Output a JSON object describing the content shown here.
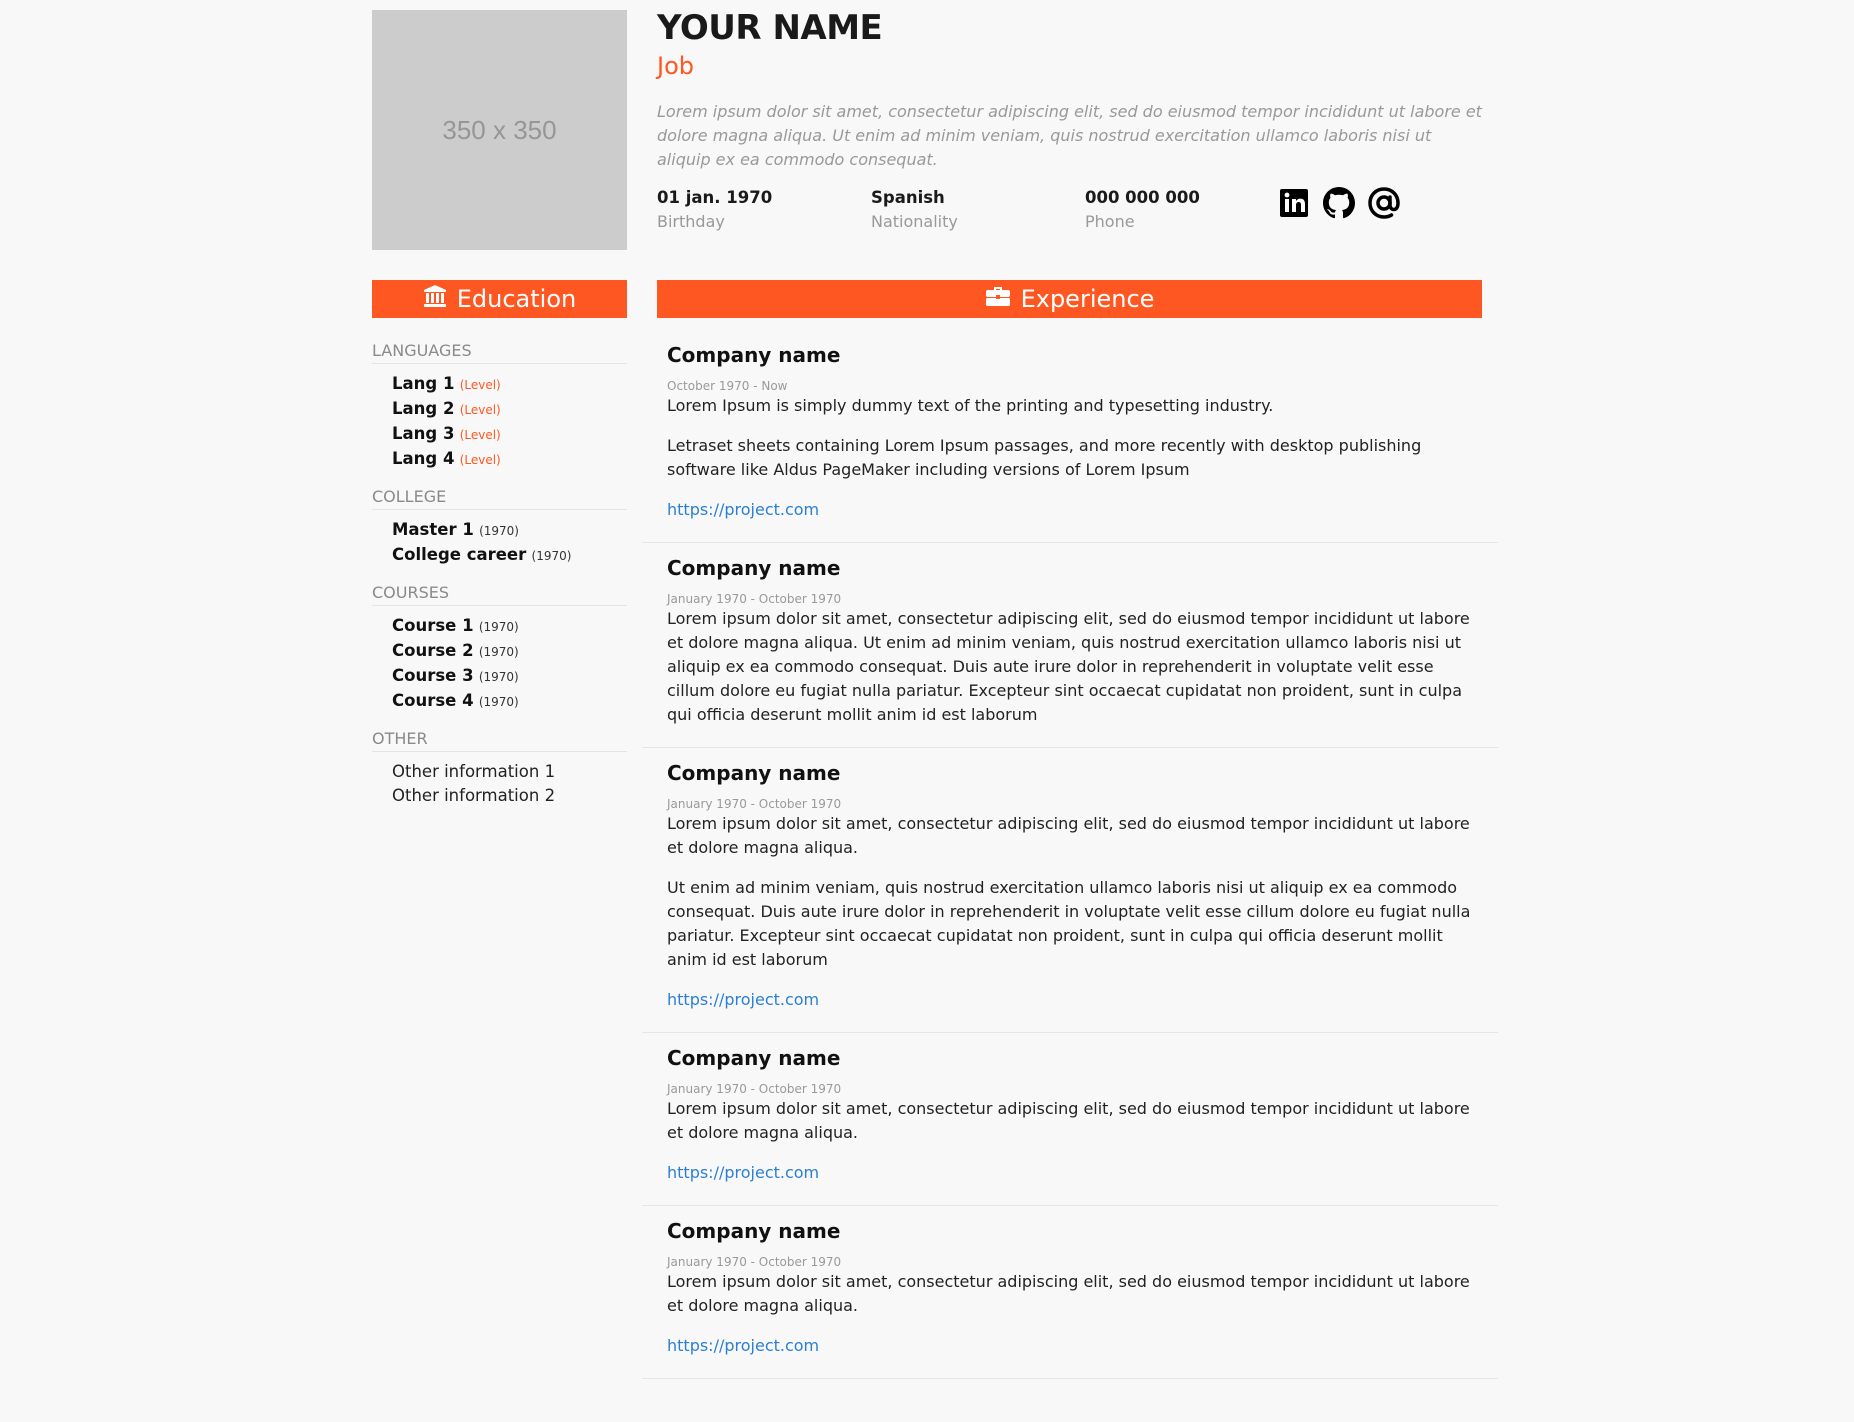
{
  "profile": {
    "photo_placeholder": "350 x 350",
    "name": "YOUR NAME",
    "job": "Job",
    "summary": "Lorem ipsum dolor sit amet, consectetur adipiscing elit, sed do eiusmod tempor incididunt ut labore et dolore magna aliqua. Ut enim ad minim veniam, quis nostrud exercitation ullamco laboris nisi ut aliquip ex ea commodo consequat.",
    "facts": [
      {
        "value": "01 jan. 1970",
        "label": "Birthday"
      },
      {
        "value": "Spanish",
        "label": "Nationality"
      },
      {
        "value": "000 000 000",
        "label": "Phone"
      }
    ],
    "social": [
      "linkedin-icon",
      "github-icon",
      "email-at-icon"
    ]
  },
  "colors": {
    "accent": "#ff5722",
    "link": "#2a7fd4",
    "muted": "#999999",
    "background": "#f8f8f8"
  },
  "education": {
    "title": "Education",
    "icon": "bank-icon",
    "languages": {
      "heading": "LANGUAGES",
      "items": [
        {
          "name": "Lang 1",
          "level": "(Level)"
        },
        {
          "name": "Lang 2",
          "level": "(Level)"
        },
        {
          "name": "Lang 3",
          "level": "(Level)"
        },
        {
          "name": "Lang 4",
          "level": "(Level)"
        }
      ]
    },
    "college": {
      "heading": "COLLEGE",
      "items": [
        {
          "name": "Master 1",
          "year": "(1970)"
        },
        {
          "name": "College career",
          "year": "(1970)"
        }
      ]
    },
    "courses": {
      "heading": "COURSES",
      "items": [
        {
          "name": "Course 1",
          "year": "(1970)"
        },
        {
          "name": "Course 2",
          "year": "(1970)"
        },
        {
          "name": "Course 3",
          "year": "(1970)"
        },
        {
          "name": "Course 4",
          "year": "(1970)"
        }
      ]
    },
    "other": {
      "heading": "OTHER",
      "items": [
        "Other information 1",
        "Other information 2"
      ]
    }
  },
  "experience": {
    "title": "Experience",
    "icon": "briefcase-icon",
    "items": [
      {
        "company": "Company name",
        "dates": "October 1970 - Now",
        "paragraphs": [
          "Lorem Ipsum is simply dummy text of the printing and typesetting industry.",
          "Letraset sheets containing Lorem Ipsum passages, and more recently with desktop publishing software like Aldus PageMaker including versions of Lorem Ipsum"
        ],
        "link": "https://project.com"
      },
      {
        "company": "Company name",
        "dates": "January 1970 - October 1970",
        "paragraphs": [
          "Lorem ipsum dolor sit amet, consectetur adipiscing elit, sed do eiusmod tempor incididunt ut labore et dolore magna aliqua. Ut enim ad minim veniam, quis nostrud exercitation ullamco laboris nisi ut aliquip ex ea commodo consequat. Duis aute irure dolor in reprehenderit in voluptate velit esse cillum dolore eu fugiat nulla pariatur. Excepteur sint occaecat cupidatat non proident, sunt in culpa qui officia deserunt mollit anim id est laborum"
        ],
        "link": ""
      },
      {
        "company": "Company name",
        "dates": "January 1970 - October 1970",
        "paragraphs": [
          "Lorem ipsum dolor sit amet, consectetur adipiscing elit, sed do eiusmod tempor incididunt ut labore et dolore magna aliqua.",
          "Ut enim ad minim veniam, quis nostrud exercitation ullamco laboris nisi ut aliquip ex ea commodo consequat. Duis aute irure dolor in reprehenderit in voluptate velit esse cillum dolore eu fugiat nulla pariatur. Excepteur sint occaecat cupidatat non proident, sunt in culpa qui officia deserunt mollit anim id est laborum"
        ],
        "link": "https://project.com"
      },
      {
        "company": "Company name",
        "dates": "January 1970 - October 1970",
        "paragraphs": [
          "Lorem ipsum dolor sit amet, consectetur adipiscing elit, sed do eiusmod tempor incididunt ut labore et dolore magna aliqua."
        ],
        "link": "https://project.com"
      },
      {
        "company": "Company name",
        "dates": "January 1970 - October 1970",
        "paragraphs": [
          "Lorem ipsum dolor sit amet, consectetur adipiscing elit, sed do eiusmod tempor incididunt ut labore et dolore magna aliqua."
        ],
        "link": "https://project.com"
      }
    ]
  }
}
